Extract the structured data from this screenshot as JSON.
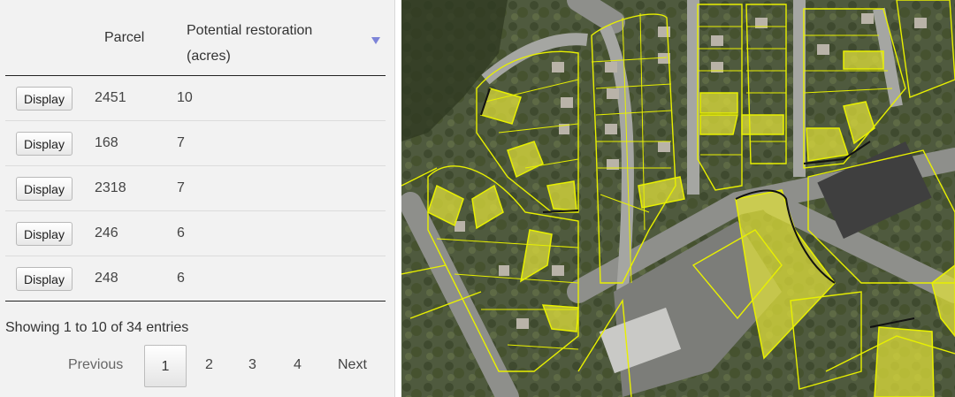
{
  "table": {
    "columns": {
      "parcel": "Parcel",
      "restoration": "Potential restoration",
      "restoration_unit": "(acres)"
    },
    "rows": [
      {
        "button": "Display",
        "parcel": "2451",
        "acres": "10"
      },
      {
        "button": "Display",
        "parcel": "168",
        "acres": "7"
      },
      {
        "button": "Display",
        "parcel": "2318",
        "acres": "7"
      },
      {
        "button": "Display",
        "parcel": "246",
        "acres": "6"
      },
      {
        "button": "Display",
        "parcel": "248",
        "acres": "6"
      }
    ],
    "sort": "descending",
    "sort_color": "#7d84d8"
  },
  "info": "Showing 1 to 10 of 34 entries",
  "pagination": {
    "previous": "Previous",
    "pages": [
      "1",
      "2",
      "3",
      "4"
    ],
    "current": "1",
    "next": "Next"
  },
  "map": {
    "type": "aerial-imagery",
    "parcel_outline_color": "#e8f000",
    "highlight_fill_color": "#e2e23a"
  }
}
